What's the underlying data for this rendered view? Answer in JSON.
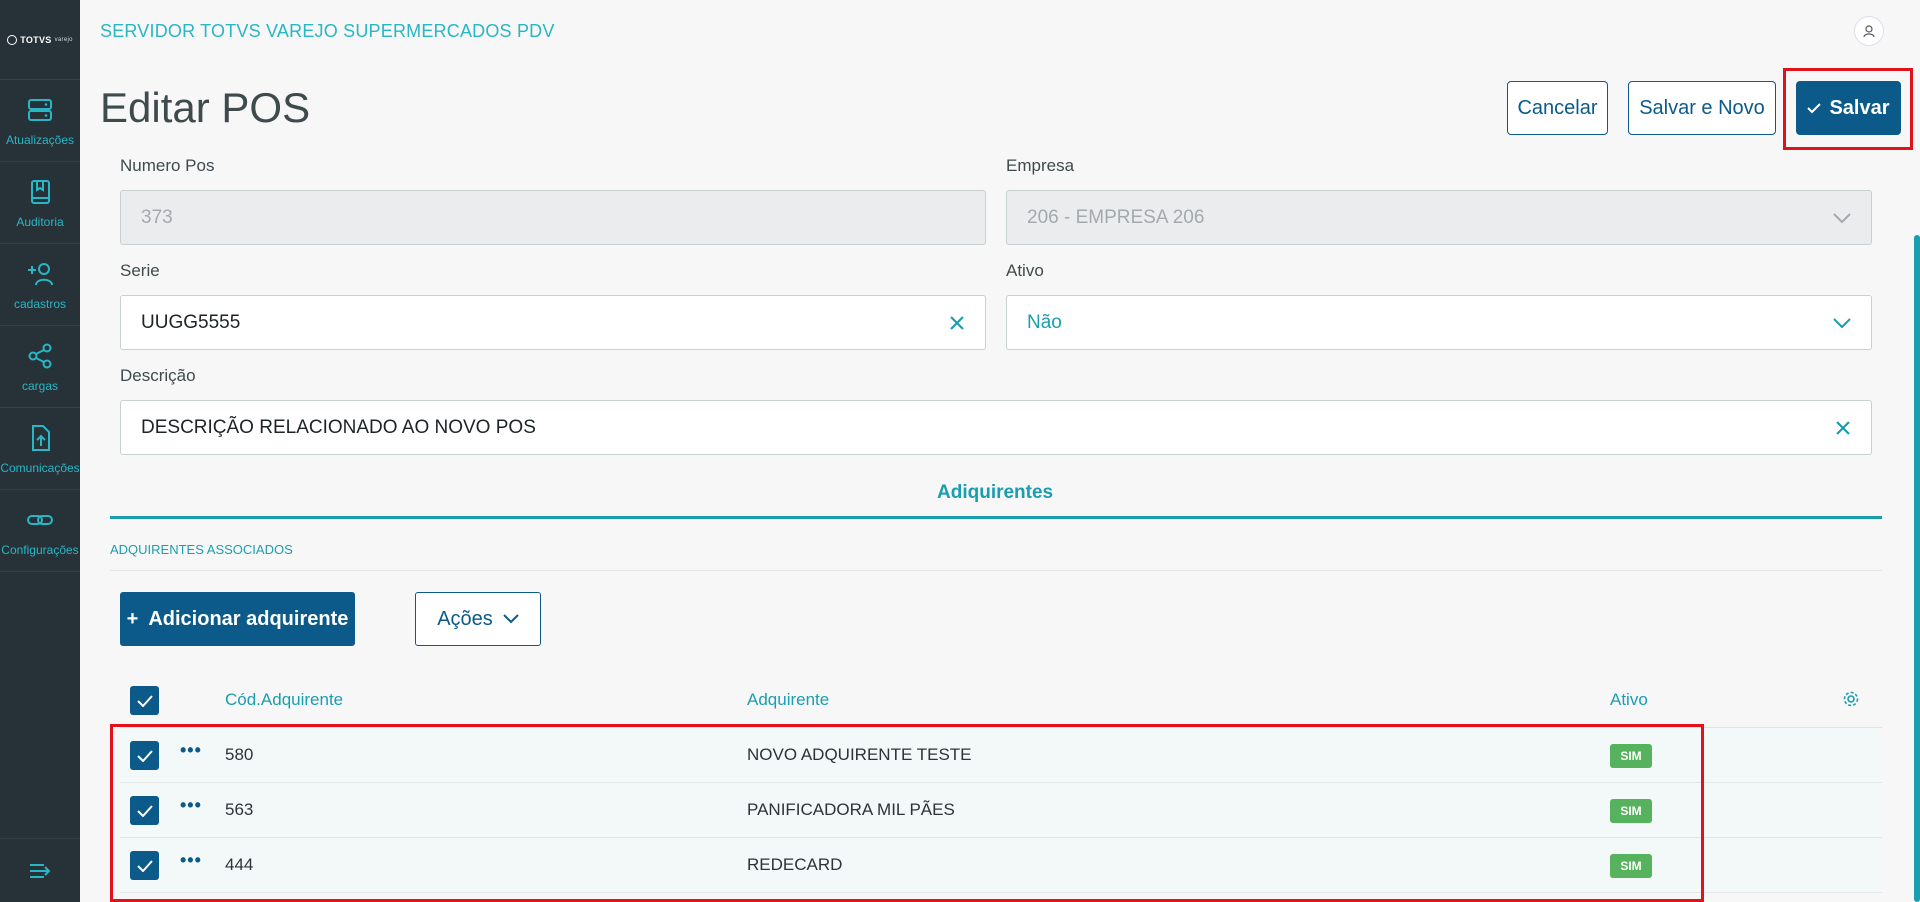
{
  "sidebar": {
    "logo": "TOTVS",
    "logo_sub": "varejo",
    "items": [
      {
        "label": "Atualizações",
        "icon": "server-icon"
      },
      {
        "label": "Auditoria",
        "icon": "bookmark-book-icon"
      },
      {
        "label": "cadastros",
        "icon": "add-user-icon"
      },
      {
        "label": "cargas",
        "icon": "share-icon"
      },
      {
        "label": "Comunicações",
        "icon": "file-upload-icon"
      },
      {
        "label": "Configurações",
        "icon": "link-icon"
      }
    ]
  },
  "header": {
    "app_title": "SERVIDOR TOTVS VAREJO SUPERMERCADOS PDV",
    "page_title": "Editar POS",
    "cancel_label": "Cancelar",
    "save_new_label": "Salvar e Novo",
    "save_label": "Salvar"
  },
  "form": {
    "numero_pos_label": "Numero Pos",
    "numero_pos_value": "373",
    "empresa_label": "Empresa",
    "empresa_value": "206 - EMPRESA 206",
    "serie_label": "Serie",
    "serie_value": "UUGG5555",
    "ativo_label": "Ativo",
    "ativo_value": "Não",
    "descricao_label": "Descrição",
    "descricao_value": "DESCRIÇÃO RELACIONADO AO NOVO POS"
  },
  "tabs": {
    "active": "Adiquirentes"
  },
  "section": {
    "label": "ADQUIRENTES ASSOCIADOS",
    "add_button": "Adicionar adquirente",
    "actions_button": "Ações"
  },
  "table": {
    "columns": [
      "Cód.Adquirente",
      "Adquirente",
      "Ativo"
    ],
    "rows": [
      {
        "code": "580",
        "name": "NOVO ADQUIRENTE TESTE",
        "ativo": "SIM"
      },
      {
        "code": "563",
        "name": "PANIFICADORA MIL PÃES",
        "ativo": "SIM"
      },
      {
        "code": "444",
        "name": "REDECARD",
        "ativo": "SIM"
      }
    ]
  },
  "colors": {
    "sidebar_bg": "#263238",
    "accent": "#1b9db0",
    "primary": "#0c5a8a",
    "badge_green": "#57b25d",
    "highlight_red": "#e0121c"
  }
}
